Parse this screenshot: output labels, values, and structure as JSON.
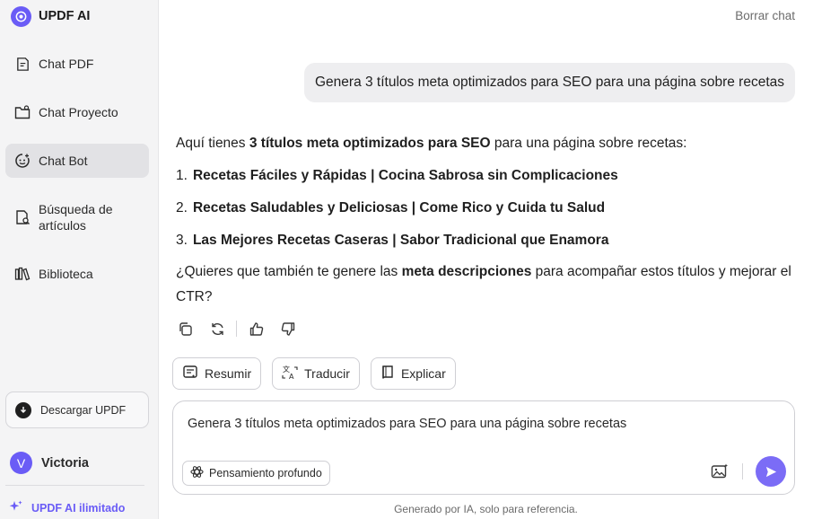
{
  "brand": {
    "name": "UPDF AI"
  },
  "sidebar": {
    "items": [
      {
        "label": "Chat PDF",
        "icon": "chat-pdf-icon"
      },
      {
        "label": "Chat Proyecto",
        "icon": "folder-chat-icon"
      },
      {
        "label": "Chat Bot",
        "icon": "bot-icon",
        "active": true
      },
      {
        "label_line1": "Búsqueda de",
        "label_line2": "artículos",
        "icon": "article-search-icon"
      },
      {
        "label": "Biblioteca",
        "icon": "library-icon"
      }
    ],
    "download_label": "Descargar UPDF",
    "user": {
      "initial": "V",
      "name": "Victoria"
    },
    "upgrade_label": "UPDF AI ilimitado"
  },
  "header": {
    "clear_chat": "Borrar chat"
  },
  "chat": {
    "user_message": "Genera 3 títulos meta optimizados para SEO para una página sobre recetas",
    "reply": {
      "intro_pre": "Aquí tienes ",
      "intro_bold": "3 títulos meta optimizados para SEO",
      "intro_post": " para una página sobre recetas:",
      "titles": [
        {
          "num": "1.",
          "text": "Recetas Fáciles y Rápidas | Cocina Sabrosa sin Complicaciones"
        },
        {
          "num": "2.",
          "text": "Recetas Saludables y Deliciosas | Come Rico y Cuida tu Salud"
        },
        {
          "num": "3.",
          "text": "Las Mejores Recetas Caseras | Sabor Tradicional que Enamora"
        }
      ],
      "tail_pre": "¿Quieres que también te genere las ",
      "tail_bold": "meta descripciones",
      "tail_post": " para acompañar estos títulos y mejorar el CTR?"
    }
  },
  "quick_actions": [
    "Resumir",
    "Traducir",
    "Explicar"
  ],
  "composer": {
    "text": "Genera 3 títulos meta optimizados para SEO para una página sobre recetas",
    "deep_think_label": "Pensamiento profundo"
  },
  "footer": {
    "disclaimer": "Generado por IA, solo para referencia."
  },
  "colors": {
    "accent": "#6a5cf6",
    "sidebar_bg": "#f4f4f5",
    "bubble_bg": "#eeeef0"
  }
}
